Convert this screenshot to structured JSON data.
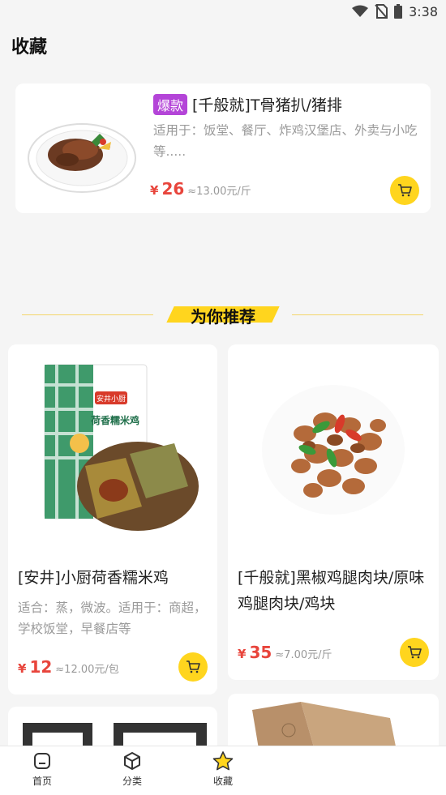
{
  "status_bar": {
    "time": "3:38"
  },
  "page": {
    "title": "收藏"
  },
  "favorites": [
    {
      "badge": "爆款",
      "title": "[千般就]T骨猪扒/猪排",
      "description": "适用于：饭堂、餐厅、炸鸡汉堡店、外卖与小吃等.....",
      "price_symbol": "¥",
      "price": "26",
      "unit_price": "≈13.00元/斤",
      "cart_icon": "cart-icon"
    }
  ],
  "recommend": {
    "header": "为你推荐",
    "items": [
      {
        "name": "[安井]小厨荷香糯米鸡",
        "description": "适合：蒸，微波。适用于：商超，学校饭堂，早餐店等",
        "price_symbol": "¥",
        "price": "12",
        "unit_price": "≈12.00元/包",
        "package_label": "荷香糯米鸡",
        "brand_label": "安井小厨"
      },
      {
        "name": "[千般就]黑椒鸡腿肉块/原味鸡腿肉块/鸡块",
        "description": "",
        "price_symbol": "¥",
        "price": "35",
        "unit_price": "≈7.00元/斤"
      }
    ]
  },
  "bottom_nav": {
    "items": [
      {
        "label": "首页",
        "icon": "home-icon"
      },
      {
        "label": "分类",
        "icon": "category-icon"
      },
      {
        "label": "收藏",
        "icon": "star-icon",
        "active": true
      }
    ]
  },
  "colors": {
    "accent": "#ffd51e",
    "price": "#e8453c",
    "badge": "#b445d8"
  }
}
